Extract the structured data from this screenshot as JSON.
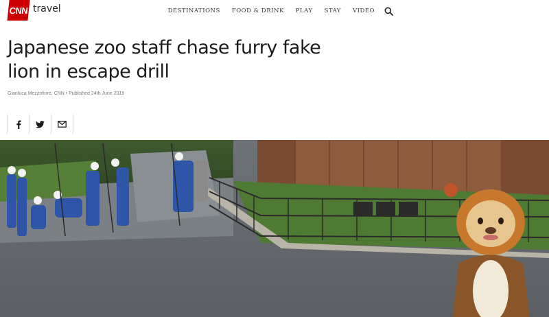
{
  "header": {
    "logo_text": "CNN",
    "brand": "travel",
    "nav": [
      "DESTINATIONS",
      "FOOD & DRINK",
      "PLAY",
      "STAY",
      "VIDEO"
    ],
    "search_icon": "search-icon"
  },
  "article": {
    "title_line1": "Japanese zoo staff chase furry fake",
    "title_line2": "lion in escape drill",
    "byline": "Gianluca Mezzofiore, CNN • Published 24th June 2019"
  },
  "share": {
    "icons": [
      "facebook-icon",
      "twitter-icon",
      "email-icon"
    ]
  },
  "colors": {
    "brand_red": "#cc0000",
    "text": "#1c1c1c",
    "muted": "#7a7a7a",
    "divider": "#d9d9d9"
  }
}
